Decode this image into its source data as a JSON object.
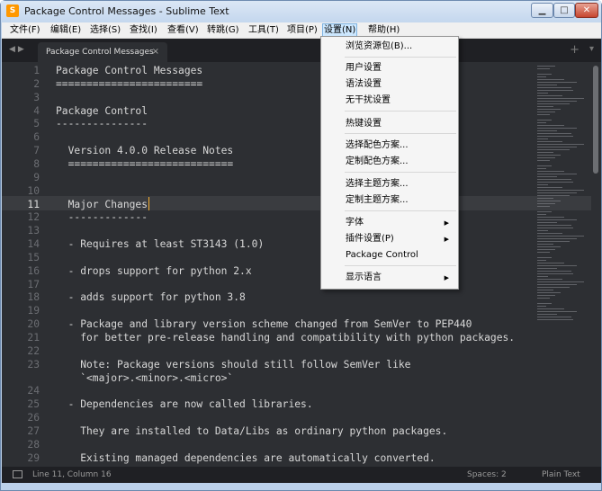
{
  "window": {
    "title": "Package Control Messages - Sublime Text",
    "icon": "sublime-text-icon",
    "controls": [
      "minimize-icon",
      "maximize-icon",
      "close-icon"
    ]
  },
  "menubar": {
    "items": [
      "文件(F)",
      "编辑(E)",
      "选择(S)",
      "查找(I)",
      "查看(V)",
      "转跳(G)",
      "工具(T)",
      "项目(P)",
      "设置(N)",
      "帮助(H)"
    ],
    "active": "设置(N)"
  },
  "tabs": {
    "nav_icons": [
      "chevron-left-icon",
      "chevron-right-icon"
    ],
    "items": [
      {
        "label": "Package Control Messages",
        "close": "×"
      }
    ],
    "plus": "+",
    "chevron": "▾"
  },
  "editor": {
    "current_line": "11",
    "lines": [
      {
        "n": "1",
        "text": "Package Control Messages"
      },
      {
        "n": "2",
        "text": "========================"
      },
      {
        "n": "3",
        "text": ""
      },
      {
        "n": "4",
        "text": "Package Control"
      },
      {
        "n": "5",
        "text": "---------------"
      },
      {
        "n": "6",
        "text": ""
      },
      {
        "n": "7",
        "text": "  Version 4.0.0 Release Notes"
      },
      {
        "n": "8",
        "text": "  ==========================="
      },
      {
        "n": "9",
        "text": ""
      },
      {
        "n": "10",
        "text": ""
      },
      {
        "n": "11",
        "text": "  Major Changes"
      },
      {
        "n": "12",
        "text": "  -------------"
      },
      {
        "n": "13",
        "text": ""
      },
      {
        "n": "14",
        "text": "  - Requires at least ST3143 (1.0)"
      },
      {
        "n": "15",
        "text": ""
      },
      {
        "n": "16",
        "text": "  - drops support for python 2.x"
      },
      {
        "n": "17",
        "text": ""
      },
      {
        "n": "18",
        "text": "  - adds support for python 3.8"
      },
      {
        "n": "19",
        "text": ""
      },
      {
        "n": "20",
        "text": "  - Package and library version scheme changed from SemVer to PEP440"
      },
      {
        "n": "21",
        "text": "    for better pre-release handling and compatibility with python packages."
      },
      {
        "n": "22",
        "text": ""
      },
      {
        "n": "23",
        "text": "    Note: Package versions should still follow SemVer like"
      },
      {
        "n": "",
        "text": "    `<major>.<minor>.<micro>`"
      },
      {
        "n": "24",
        "text": ""
      },
      {
        "n": "25",
        "text": "  - Dependencies are now called libraries."
      },
      {
        "n": "26",
        "text": ""
      },
      {
        "n": "27",
        "text": "    They are installed to Data/Libs as ordinary python packages."
      },
      {
        "n": "28",
        "text": ""
      },
      {
        "n": "29",
        "text": "    Existing managed dependencies are automatically converted."
      }
    ]
  },
  "settings_menu": {
    "items": [
      {
        "label": "浏览资源包(B)...",
        "submenu": false
      },
      {
        "label": "用户设置",
        "submenu": false
      },
      {
        "label": "语法设置",
        "submenu": false
      },
      {
        "label": "无干扰设置",
        "submenu": false
      },
      {
        "label": "热键设置",
        "submenu": false
      },
      {
        "label": "选择配色方案...",
        "submenu": false
      },
      {
        "label": "定制配色方案...",
        "submenu": false
      },
      {
        "label": "选择主题方案...",
        "submenu": false
      },
      {
        "label": "定制主题方案...",
        "submenu": false
      },
      {
        "label": "字体",
        "submenu": true
      },
      {
        "label": "插件设置(P)",
        "submenu": true
      },
      {
        "label": "Package Control",
        "submenu": false
      },
      {
        "label": "显示语言",
        "submenu": true
      }
    ],
    "submenu_arrow": "▶"
  },
  "statusbar": {
    "position": "Line 11, Column 16",
    "indent": "Spaces: 2",
    "syntax": "Plain Text"
  },
  "colors": {
    "editor_bg": "#2d2f33",
    "caret": "#f9b233",
    "titlebar": "#c4d7ee"
  }
}
